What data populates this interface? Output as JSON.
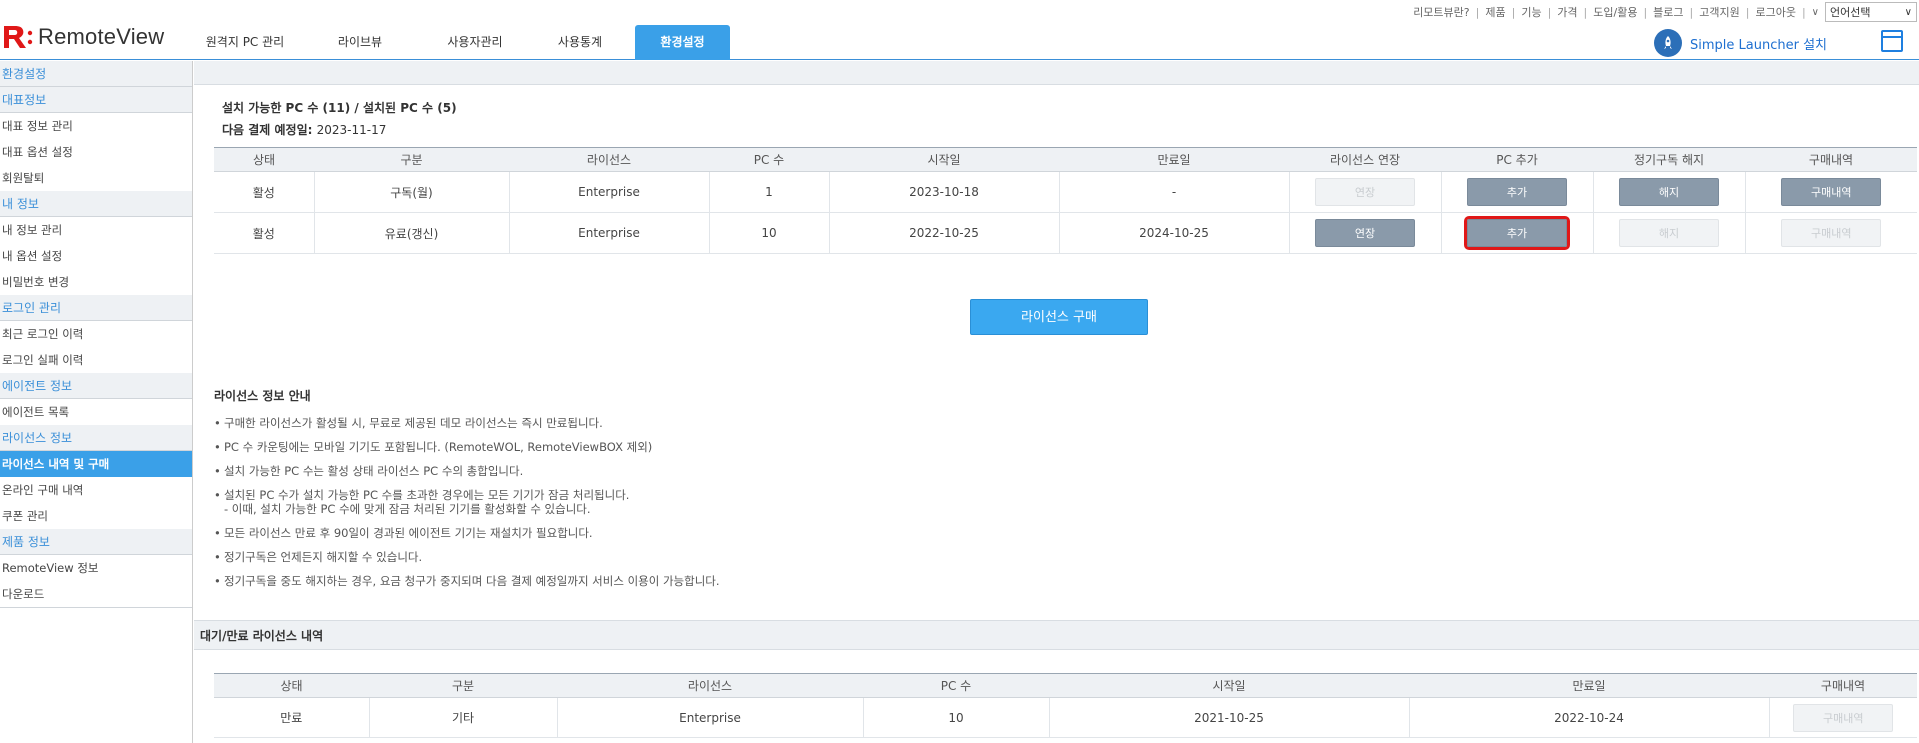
{
  "brand": {
    "name": "RemoteView",
    "accent": "#e01818",
    "primary": "#3aa0e8"
  },
  "utility_links": [
    "리모트뷰란?",
    "제품",
    "기능",
    "가격",
    "도입/활용",
    "블로그",
    "고객지원",
    "로그아웃"
  ],
  "language_select": {
    "value": "언어선택",
    "icon": "chevron-down-icon"
  },
  "nav_tabs": [
    {
      "label": "원격지 PC 관리",
      "active": false
    },
    {
      "label": "라이브뷰",
      "active": false
    },
    {
      "label": "사용자관리",
      "active": false
    },
    {
      "label": "사용통계",
      "active": false
    },
    {
      "label": "환경설정",
      "active": true
    }
  ],
  "launcher": {
    "label": "Simple Launcher 설치",
    "icon": "rocket-icon"
  },
  "sidebar": {
    "title": "환경설정",
    "groups": [
      {
        "label": "대표정보",
        "items": [
          "대표 정보 관리",
          "대표 옵션 설정",
          "회원탈퇴"
        ]
      },
      {
        "label": "내 정보",
        "items": [
          "내 정보 관리",
          "내 옵션 설정",
          "비밀번호 변경"
        ]
      },
      {
        "label": "로그인 관리",
        "items": [
          "최근 로그인 이력",
          "로그인 실패 이력"
        ]
      },
      {
        "label": "에이전트 정보",
        "items": [
          "에이전트 목록"
        ]
      },
      {
        "label": "라이선스 정보",
        "items": [
          "라이선스 내역 및 구매",
          "온라인 구매 내역",
          "쿠폰 관리"
        ]
      },
      {
        "label": "제품 정보",
        "items": [
          "RemoteView 정보",
          "다운로드"
        ]
      }
    ],
    "active_item": "라이선스 내역 및 구매"
  },
  "summary": {
    "line1": "설치 가능한 PC 수 (11) / 설치된 PC 수 (5)",
    "line2_label": "다음 결제 예정일:",
    "line2_value": "2023-11-17"
  },
  "license_table": {
    "headers": [
      "상태",
      "구분",
      "라이선스",
      "PC 수",
      "시작일",
      "만료일",
      "라이선스 연장",
      "PC 추가",
      "정기구독 해지",
      "구매내역"
    ],
    "rows": [
      {
        "status": "활성",
        "type": "구독(월)",
        "license": "Enterprise",
        "pc_count": "1",
        "start": "2023-10-18",
        "end": "-",
        "extend": {
          "label": "연장",
          "enabled": false
        },
        "add": {
          "label": "추가",
          "enabled": true
        },
        "cancel": {
          "label": "해지",
          "enabled": true
        },
        "history": {
          "label": "구매내역",
          "enabled": true
        }
      },
      {
        "status": "활성",
        "type": "유료(갱신)",
        "license": "Enterprise",
        "pc_count": "10",
        "start": "2022-10-25",
        "end": "2024-10-25",
        "extend": {
          "label": "연장",
          "enabled": true
        },
        "add": {
          "label": "추가",
          "enabled": true,
          "highlighted": true
        },
        "cancel": {
          "label": "해지",
          "enabled": false
        },
        "history": {
          "label": "구매내역",
          "enabled": false
        }
      }
    ]
  },
  "buy_button": "라이선스 구매",
  "notice": {
    "title": "라이선스 정보 안내",
    "items": [
      {
        "text": "구매한 라이선스가 활성될 시, 무료로 제공된 데모 라이선스는 즉시 만료됩니다."
      },
      {
        "text": "PC 수 카운팅에는 모바일 기기도 포함됩니다. (RemoteWOL, RemoteViewBOX 제외)"
      },
      {
        "text": "설치 가능한 PC 수는 활성 상태 라이선스 PC 수의 총합입니다."
      },
      {
        "text": "설치된 PC 수가 설치 가능한 PC 수를 초과한 경우에는 모든 기기가 잠금 처리됩니다.",
        "sub": "- 이때, 설치 가능한 PC 수에 맞게 잠금 처리된 기기를 활성화할 수 있습니다."
      },
      {
        "text": "모든 라이선스 만료 후 90일이 경과된 에이전트 기기는 재설치가 필요합니다."
      },
      {
        "text": "정기구독은 언제든지 해지할 수 있습니다."
      },
      {
        "text": "정기구독을 중도 해지하는 경우, 요금 청구가 중지되며 다음 결제 예정일까지 서비스 이용이 가능합니다."
      }
    ]
  },
  "expired_section": {
    "title": "대기/만료 라이선스 내역",
    "headers": [
      "상태",
      "구분",
      "라이선스",
      "PC 수",
      "시작일",
      "만료일",
      "구매내역"
    ],
    "rows": [
      {
        "status": "만료",
        "type": "기타",
        "license": "Enterprise",
        "pc_count": "10",
        "start": "2021-10-25",
        "end": "2022-10-24",
        "history": {
          "label": "구매내역",
          "enabled": false
        }
      }
    ]
  }
}
